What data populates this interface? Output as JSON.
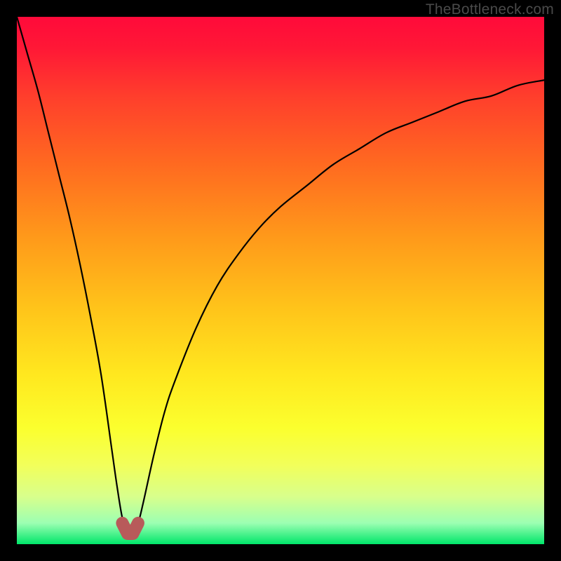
{
  "watermark": "TheBottleneck.com",
  "colors": {
    "frame_bg": "#000000",
    "gradient_top": "#ff0a3a",
    "gradient_bottom": "#00e66a",
    "curve": "#000000",
    "marker": "#b85a5a"
  },
  "chart_data": {
    "type": "line",
    "title": "",
    "xlabel": "",
    "ylabel": "",
    "xlim": [
      0,
      100
    ],
    "ylim": [
      0,
      100
    ],
    "grid": false,
    "legend": false,
    "notes": "V-shaped bottleneck curve: percentage bottleneck vs. a normalized x-axis. Minimum ~0 near x≈21; axes shown without tick labels. Background is a red→green vertical gradient (red top = bad, green bottom = good).",
    "series": [
      {
        "name": "bottleneck-curve",
        "x": [
          0,
          2,
          4,
          6,
          8,
          10,
          12,
          14,
          16,
          18,
          19,
          20,
          21,
          22,
          23,
          24,
          26,
          28,
          30,
          34,
          38,
          42,
          46,
          50,
          55,
          60,
          65,
          70,
          75,
          80,
          85,
          90,
          95,
          100
        ],
        "y": [
          100,
          93,
          86,
          78,
          70,
          62,
          53,
          43,
          32,
          18,
          11,
          5,
          2,
          2,
          4,
          8,
          17,
          25,
          31,
          41,
          49,
          55,
          60,
          64,
          68,
          72,
          75,
          78,
          80,
          82,
          84,
          85,
          87,
          88
        ]
      }
    ],
    "marker": {
      "name": "minimum-region",
      "x": [
        20,
        21,
        22,
        23
      ],
      "y": [
        4,
        2,
        2,
        4
      ]
    }
  }
}
